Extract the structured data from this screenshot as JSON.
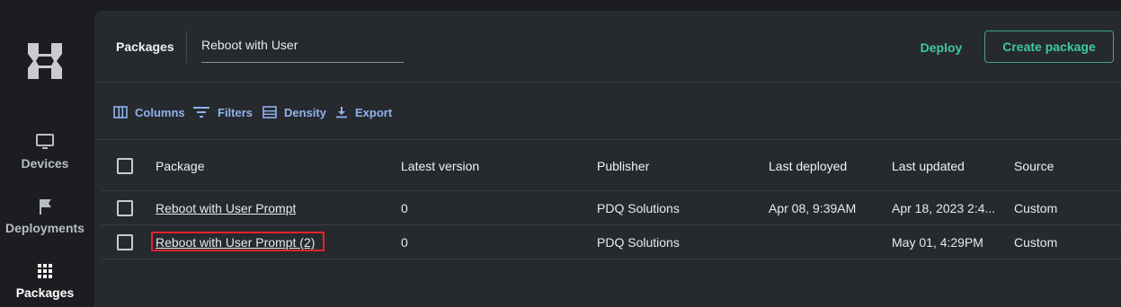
{
  "sidebar": {
    "logo_icon": "hex-logo-icon",
    "items": [
      {
        "label": "Devices",
        "icon": "monitor-icon"
      },
      {
        "label": "Deployments",
        "icon": "flag-icon"
      },
      {
        "label": "Packages",
        "icon": "grid-icon",
        "active": true
      }
    ]
  },
  "header": {
    "title": "Packages",
    "search_value": "Reboot with User",
    "deploy_label": "Deploy",
    "create_label": "Create package"
  },
  "toolbar": {
    "columns": "Columns",
    "filters": "Filters",
    "density": "Density",
    "export": "Export"
  },
  "table": {
    "headers": [
      "Package",
      "Latest version",
      "Publisher",
      "Last deployed",
      "Last updated",
      "Source"
    ],
    "rows": [
      {
        "package": "Reboot with User Prompt",
        "version": "0",
        "publisher": "PDQ Solutions",
        "last_deployed": "Apr 08, 9:39AM",
        "last_updated": "Apr 18, 2023 2:4...",
        "source": "Custom"
      },
      {
        "package": "Reboot with User Prompt (2)",
        "version": "0",
        "publisher": "PDQ Solutions",
        "last_deployed": "",
        "last_updated": "May 01, 4:29PM",
        "source": "Custom"
      }
    ]
  },
  "colors": {
    "accent": "#3fc8a3",
    "toolbar_text": "#8fb3ea",
    "highlight": "#e0242b"
  }
}
